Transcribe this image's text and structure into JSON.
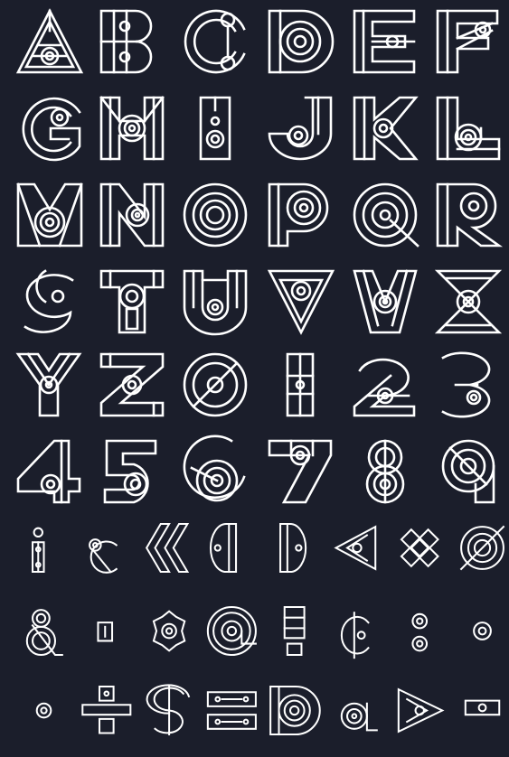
{
  "sheet": {
    "background": "#1b1e2b",
    "ink": "#ffffff",
    "rows": [
      [
        "A",
        "B",
        "C",
        "D",
        "E",
        "F"
      ],
      [
        "G",
        "H",
        "I",
        "J",
        "K",
        "L"
      ],
      [
        "M",
        "N",
        "O",
        "P",
        "Q",
        "R"
      ],
      [
        "S",
        "T",
        "U",
        "V",
        "W",
        "X"
      ],
      [
        "Y",
        "Z",
        "0",
        "1",
        "2",
        "3"
      ],
      [
        "4",
        "5",
        "6",
        "7",
        "8",
        "9"
      ],
      [
        "i",
        "c",
        "«",
        "(",
        ")",
        "◁",
        "✕",
        "⊘"
      ],
      [
        "&",
        ".",
        "*",
        "@",
        "!",
        "¢",
        ":",
        "o"
      ],
      [
        "°",
        "÷",
        "$",
        "=",
        "D",
        "a",
        "▷",
        "-"
      ]
    ]
  }
}
